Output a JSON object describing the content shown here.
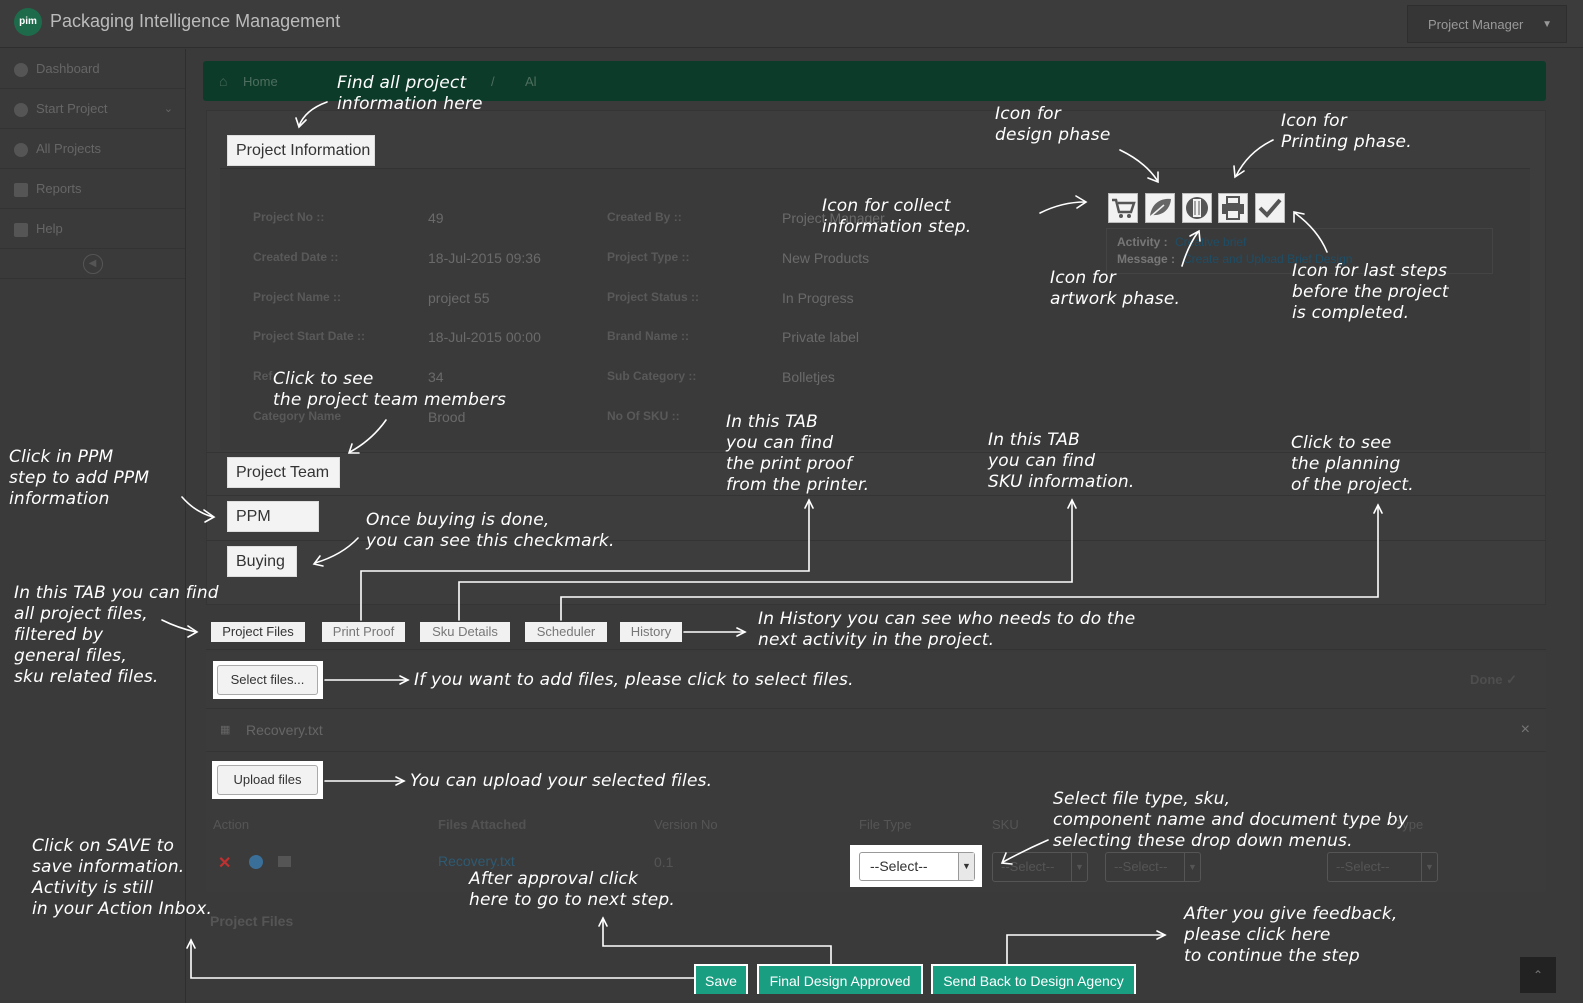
{
  "header": {
    "logo": "pim",
    "title": "Packaging Intelligence Management",
    "user": "Project Manager"
  },
  "sidebar": {
    "items": [
      {
        "label": "Dashboard",
        "icon": "dashboard-icon"
      },
      {
        "label": "Start Project",
        "icon": "start-icon"
      },
      {
        "label": "All Projects",
        "icon": "projects-icon"
      },
      {
        "label": "Reports",
        "icon": "reports-icon"
      },
      {
        "label": "Help",
        "icon": "help-icon"
      }
    ]
  },
  "breadcrumb": {
    "home": "Home",
    "current": "Al"
  },
  "sections": {
    "project_information": "Project Information",
    "project_team": "Project Team",
    "ppm": "PPM",
    "buying": "Buying"
  },
  "project": {
    "no_label": "Project No ::",
    "no": "49",
    "created_by_label": "Created By ::",
    "created_by": "Project Manager",
    "created_date_label": "Created Date ::",
    "created_date": "18-Jul-2015 09:36",
    "type_label": "Project Type ::",
    "type": "New Products",
    "name_label": "Project Name ::",
    "name": "project 55",
    "status_label": "Project Status ::",
    "status": "In Progress",
    "start_label": "Project Start Date ::",
    "start": "18-Jul-2015 00:00",
    "brand_label": "Brand Name ::",
    "brand": "Private label",
    "ref_label": "Ref",
    "ref": "34",
    "subcat_label": "Sub Category ::",
    "subcat": "Bolletjes",
    "category_label": "Category Name",
    "category": "Brood",
    "sku_label": "No Of SKU ::"
  },
  "activity": {
    "activity_label": "Activity :",
    "activity": "Creative brief",
    "message_label": "Message :",
    "message": "Create and Upload Brief Design"
  },
  "tabs": [
    "Project Files",
    "Print Proof",
    "Sku Details",
    "Scheduler",
    "History"
  ],
  "files": {
    "select_btn": "Select files...",
    "done": "Done",
    "file_name": "Recovery.txt",
    "upload_btn": "Upload files",
    "headers": {
      "action": "Action",
      "attached": "Files Attached",
      "version": "Version No",
      "file_type": "File Type",
      "sku": "SKU",
      "doc_type": "Type"
    },
    "row": {
      "file": "Recovery.txt",
      "version": "0.1"
    },
    "select_placeholder": "--Select--",
    "section_title": "Project Files"
  },
  "actions": {
    "save": "Save",
    "final_approved": "Final Design Approved",
    "send_back": "Send Back to Design Agency"
  },
  "annotations": {
    "find_info": "Find all project\ninformation here",
    "design_icon": "Icon for\ndesign phase",
    "printing_icon": "Icon for\nPrinting phase.",
    "collect_icon": "Icon for collect\ninformation step.",
    "artwork_icon": "Icon for\nartwork phase.",
    "last_steps": "Icon for last steps\nbefore the project\nis completed.",
    "team": "Click to see\nthe project team members",
    "ppm": "Click in PPM\nstep to add PPM\ninformation",
    "buying": "Once buying is done,\nyou can see this checkmark.",
    "print_tab": "In this TAB\nyou can find\nthe print proof\nfrom the printer.",
    "sku_tab": "In this TAB\nyou can find\nSKU information.",
    "planning": "Click to see\nthe planning\nof the project.",
    "files_tab": "In this TAB you can find\nall project files,\nfiltered by\ngeneral files,\nsku related files.",
    "history": "In History you can see who needs to do the\nnext activity in the project.",
    "select_files": "If you want to add files, please click to select files.",
    "upload": "You can upload your selected files.",
    "dropdowns": "Select file type, sku,\ncomponent name and document type by\nselecting these drop down menus.",
    "save": "Click on SAVE to\nsave information.\nActivity is still\nin your Action Inbox.",
    "approval": "After approval click\nhere to go to next step.",
    "feedback": "After you give feedback,\nplease click here\nto continue the step"
  }
}
